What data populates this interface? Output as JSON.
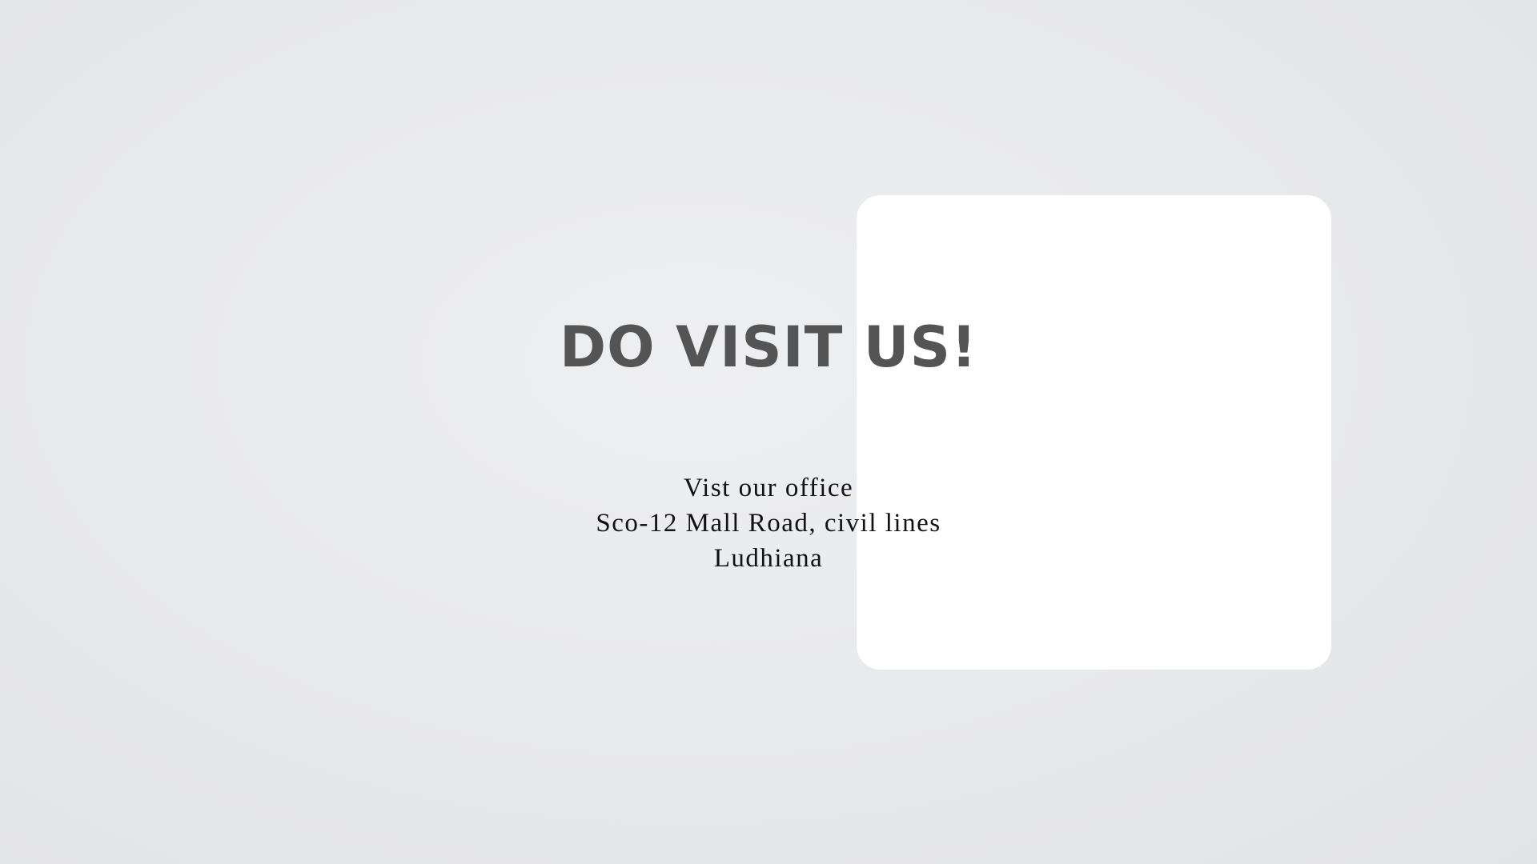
{
  "card": {
    "title": "DO VISIT US!",
    "lines": [
      "Vist our office",
      "Sco-12 Mall Road, civil lines",
      "Ludhiana"
    ]
  },
  "colors": {
    "background": "#e9eaec",
    "card": "#ffffff",
    "title": "#545454",
    "body_text": "#111111"
  }
}
